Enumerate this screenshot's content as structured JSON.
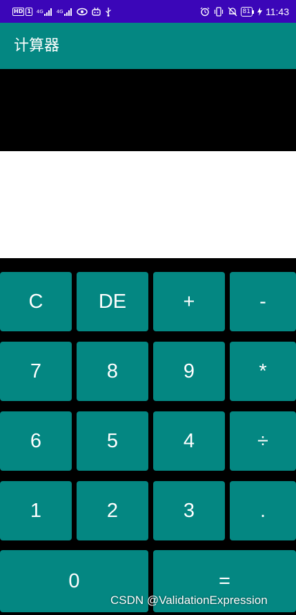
{
  "status_bar": {
    "badges": [
      "HD",
      "1"
    ],
    "network_1": "4G",
    "network_2": "4G",
    "battery_level": "81",
    "time": "11:43",
    "icons": [
      "eye-icon",
      "notification-bot-icon",
      "usb-icon",
      "alarm-icon",
      "vibrate-icon",
      "mute-bell-icon",
      "charging-icon"
    ]
  },
  "app_bar": {
    "title": "计算器"
  },
  "display": {
    "expression": "",
    "result": ""
  },
  "keypad": {
    "rows": [
      [
        "C",
        "DE",
        "+",
        "-"
      ],
      [
        "7",
        "8",
        "9",
        "*"
      ],
      [
        "6",
        "5",
        "4",
        "÷"
      ],
      [
        "1",
        "2",
        "3",
        "."
      ],
      [
        "0",
        "="
      ]
    ]
  },
  "watermark": "CSDN @ValidationExpression",
  "colors": {
    "status_bar": "#3b06b8",
    "accent": "#048782",
    "key_text": "#ffffff",
    "keypad_background": "#000000",
    "expression_background": "#000000",
    "result_background": "#ffffff"
  }
}
